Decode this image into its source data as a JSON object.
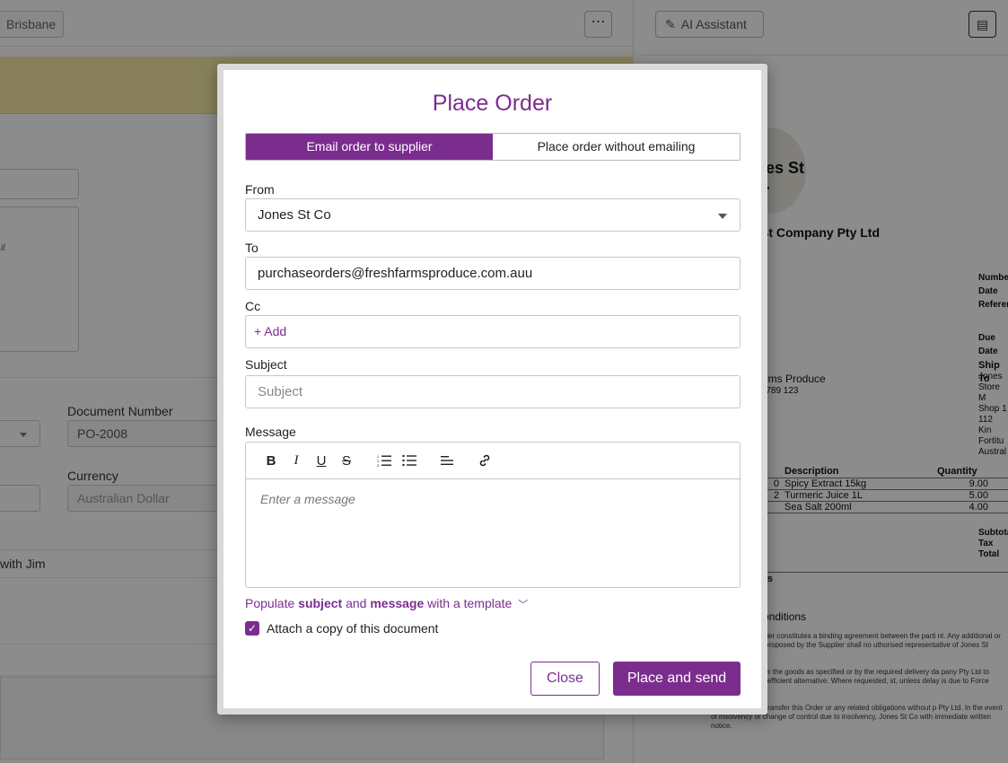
{
  "background": {
    "location_chip": "Brisbane",
    "more_button": "⋯",
    "partial_text_email": "il",
    "document_number_label": "Document Number",
    "document_number_value": "PO-2008",
    "currency_label": "Currency",
    "currency_value": "Australian Dollar",
    "row_text": "with Jim",
    "ai_assistant_label": "AI Assistant",
    "doc_preview": {
      "logo_text": "nes St\no.",
      "company_name": "St Company Pty Ltd",
      "meta_labels": [
        "Number",
        "Date",
        "Reference",
        "Due Date"
      ],
      "ship_to_label": "Ship To",
      "ship_to_lines": [
        "Jones",
        "Store M",
        "Shop 1",
        "112 Kin",
        "Fortitu",
        "Austral"
      ],
      "supplier_line1": "arms Produce",
      "supplier_line2": "6 789 123",
      "table_headers": [
        "Description",
        "Quantity"
      ],
      "table_rows": [
        [
          "0",
          "Spicy Extract 15kg",
          "9.00"
        ],
        [
          "2",
          "Turmeric Juice 1L",
          "5.00"
        ],
        [
          "",
          "Sea Salt 200ml",
          "4.00"
        ]
      ],
      "totals_labels": [
        "Subtotal",
        "Tax",
        "Total"
      ],
      "notes_label": "tes",
      "terms_heading": "d conditions",
      "terms_p1": "this Purchase Order constitutes a binding agreement between the parti nt. Any additional or conflicting terms proposed by the Supplier shall no uthorised representative of Jones St Company Pty Ltd.",
      "terms_p2": "is unable to deliver the goods as specified or by the required delivery da pany Pty Ltd to arrange the most efficient alternative. Where requested, st, unless delay is due to Force Majeure.",
      "terms_p3": "ust not assign or transfer this Order or any related obligations without p Pty Ltd. In the event of insolvency or change of control due to insolvency, Jones St Co with immediate written notice."
    }
  },
  "modal": {
    "title": "Place Order",
    "tabs": [
      {
        "label": "Email order to supplier",
        "active": true
      },
      {
        "label": "Place order without emailing",
        "active": false
      }
    ],
    "from": {
      "label": "From",
      "value": "Jones St Co"
    },
    "to": {
      "label": "To",
      "value": "purchaseorders@freshfarmsproduce.com.auu"
    },
    "cc": {
      "label": "Cc",
      "add_label": "+ Add"
    },
    "subject": {
      "label": "Subject",
      "placeholder": "Subject"
    },
    "message": {
      "label": "Message",
      "placeholder": "Enter a message"
    },
    "template_link": {
      "prefix": "Populate ",
      "subject_word": "subject",
      "middle": " and ",
      "message_word": "message",
      "suffix": " with a template"
    },
    "attach": {
      "label": "Attach a copy of this document",
      "checked": true
    },
    "close_label": "Close",
    "send_label": "Place and send"
  },
  "colors": {
    "accent": "#7b2d8e",
    "overlay": "rgba(0,0,0,0.45)"
  }
}
